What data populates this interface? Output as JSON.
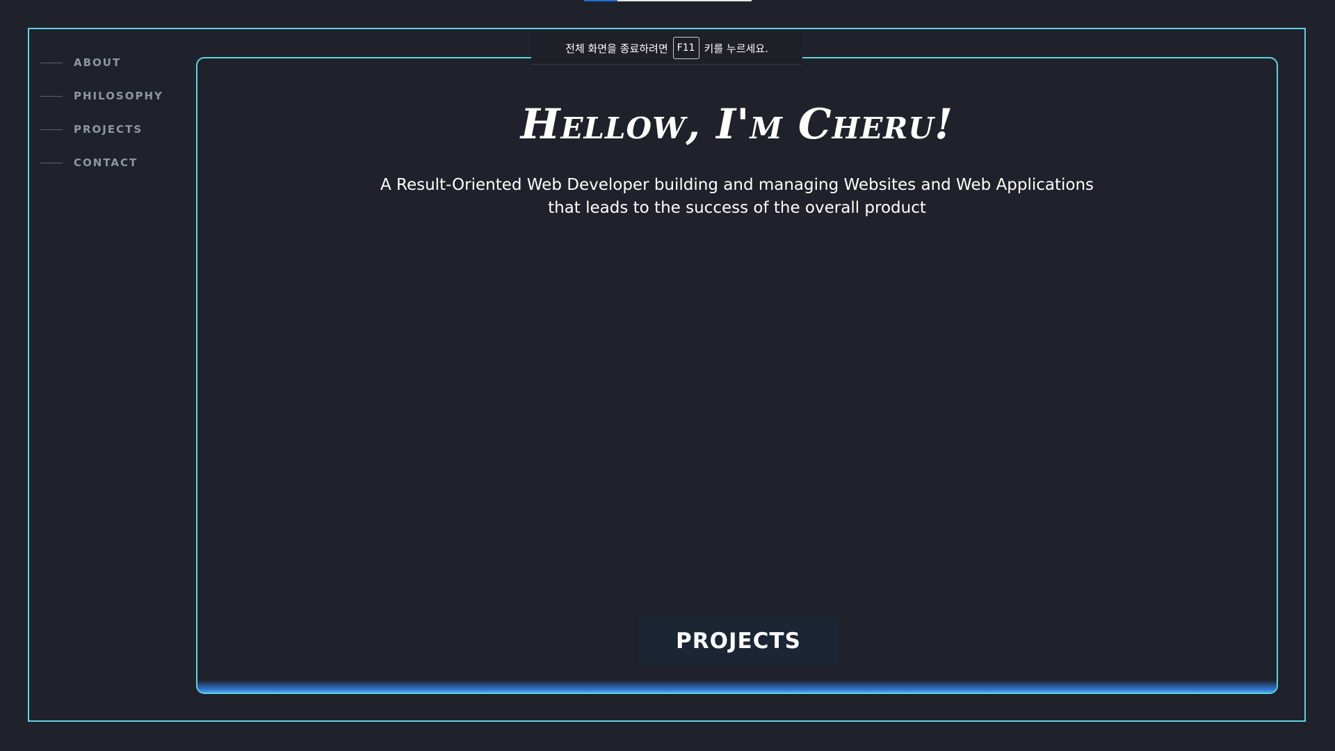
{
  "sidebar": {
    "items": [
      {
        "label": "ABOUT"
      },
      {
        "label": "PHILOSOPHY"
      },
      {
        "label": "PROJECTS"
      },
      {
        "label": "CONTACT"
      }
    ]
  },
  "hero": {
    "title": "Hellow, I'm Cheru!",
    "subtitle": "A Result-Oriented Web Developer building and managing Websites and Web Applications that leads to the success of the overall product"
  },
  "projects_button": {
    "label": "PROJECTS"
  },
  "fullscreen_notice": {
    "prefix": "전체 화면을 종료하려면",
    "key": "F11",
    "suffix": "키를 누르세요."
  },
  "colors": {
    "background": "#1f222a",
    "frame_accent": "#5fd3e6",
    "button_bg": "#1b2533",
    "glow": "#4aa3f0"
  }
}
